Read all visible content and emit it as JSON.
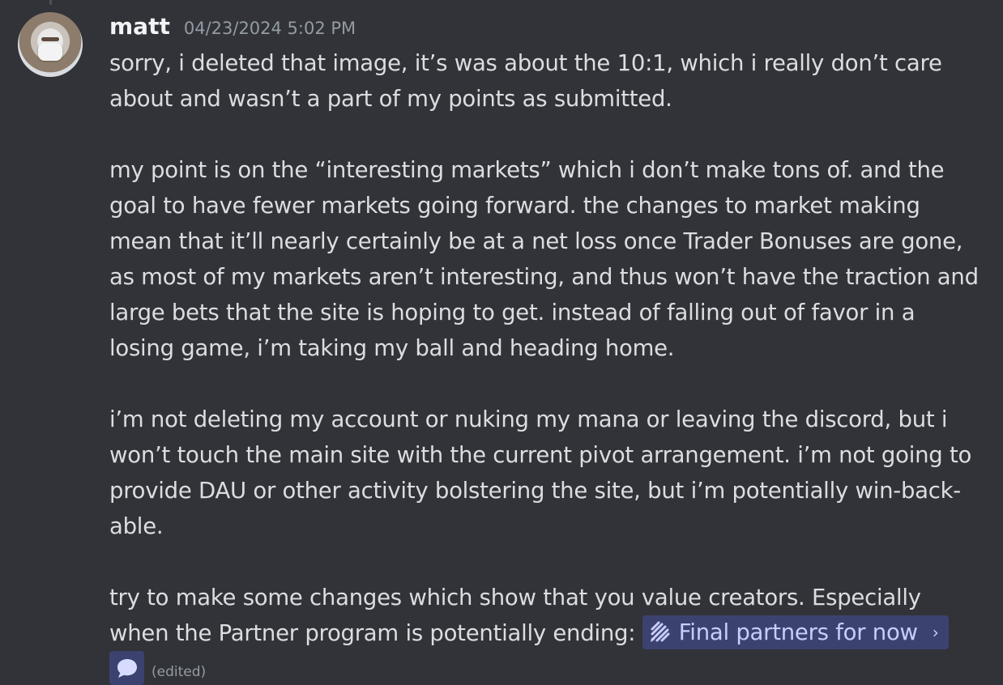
{
  "message": {
    "username": "matt",
    "timestamp": "04/23/2024 5:02 PM",
    "paragraphs": [
      {
        "lines": [
          "sorry, i deleted that image, it’s was about the 10:1, which i really don’t care",
          "about and wasn’t a part of my points as submitted."
        ]
      },
      {
        "lines": [
          "my point is on the “interesting markets” which i don’t make tons of. and the",
          "goal to have fewer markets going forward. the changes to market making",
          "mean that it’ll nearly certainly be at a net loss once Trader Bonuses are gone,",
          "as most of my markets aren’t interesting, and thus won’t have the traction and",
          "large bets that the site is hoping to get. instead of falling out of favor in a",
          "losing game, i’m taking my ball and heading home."
        ]
      },
      {
        "lines": [
          "i’m not deleting my account or nuking my mana or leaving the discord, but i",
          "won’t touch the main site with the current pivot arrangement. i’m not going to",
          "provide DAU or other activity bolstering the site, but i’m potentially win-back-",
          "able."
        ]
      },
      {
        "lines": [
          "try to make some changes which show that you value creators. Especially",
          "when the Partner program is potentially ending: "
        ]
      }
    ],
    "thread_link": {
      "label": "Final partners for now",
      "chevron": "›",
      "icon": "thread-icon"
    },
    "edited_label": "(edited)"
  },
  "colors": {
    "background": "#313338",
    "text": "#dbdee1",
    "username": "#f2f3f5",
    "muted": "#949ba4",
    "mention_bg": "#3c4270",
    "mention_text": "#c9cdfb"
  }
}
